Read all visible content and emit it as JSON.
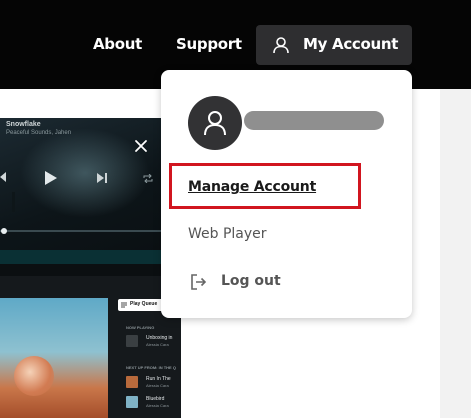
{
  "nav": {
    "about_label": "About",
    "support_label": "Support",
    "account_label": "My Account"
  },
  "dropdown": {
    "manage_account_label": "Manage Account",
    "web_player_label": "Web Player",
    "logout_label": "Log out"
  },
  "player": {
    "track_title": "Snowflake",
    "track_artist": "Peaceful Sounds, Jahen"
  },
  "queue": {
    "play_queue_label": "Play Queue",
    "now_playing_label": "NOW PLAYING",
    "next_up_label": "NEXT UP FROM: IN THE Q",
    "items": [
      {
        "title": "Unboxing in",
        "artist": "Alessia Cara"
      },
      {
        "title": "Run In The",
        "artist": "Alessia Cara"
      },
      {
        "title": "Bluebird",
        "artist": "Alessia Cara"
      }
    ]
  },
  "colors": {
    "nav_bg": "#050505",
    "account_button_bg": "#2e2e30",
    "highlight": "#d1151f",
    "avatar_bg": "#323234"
  }
}
